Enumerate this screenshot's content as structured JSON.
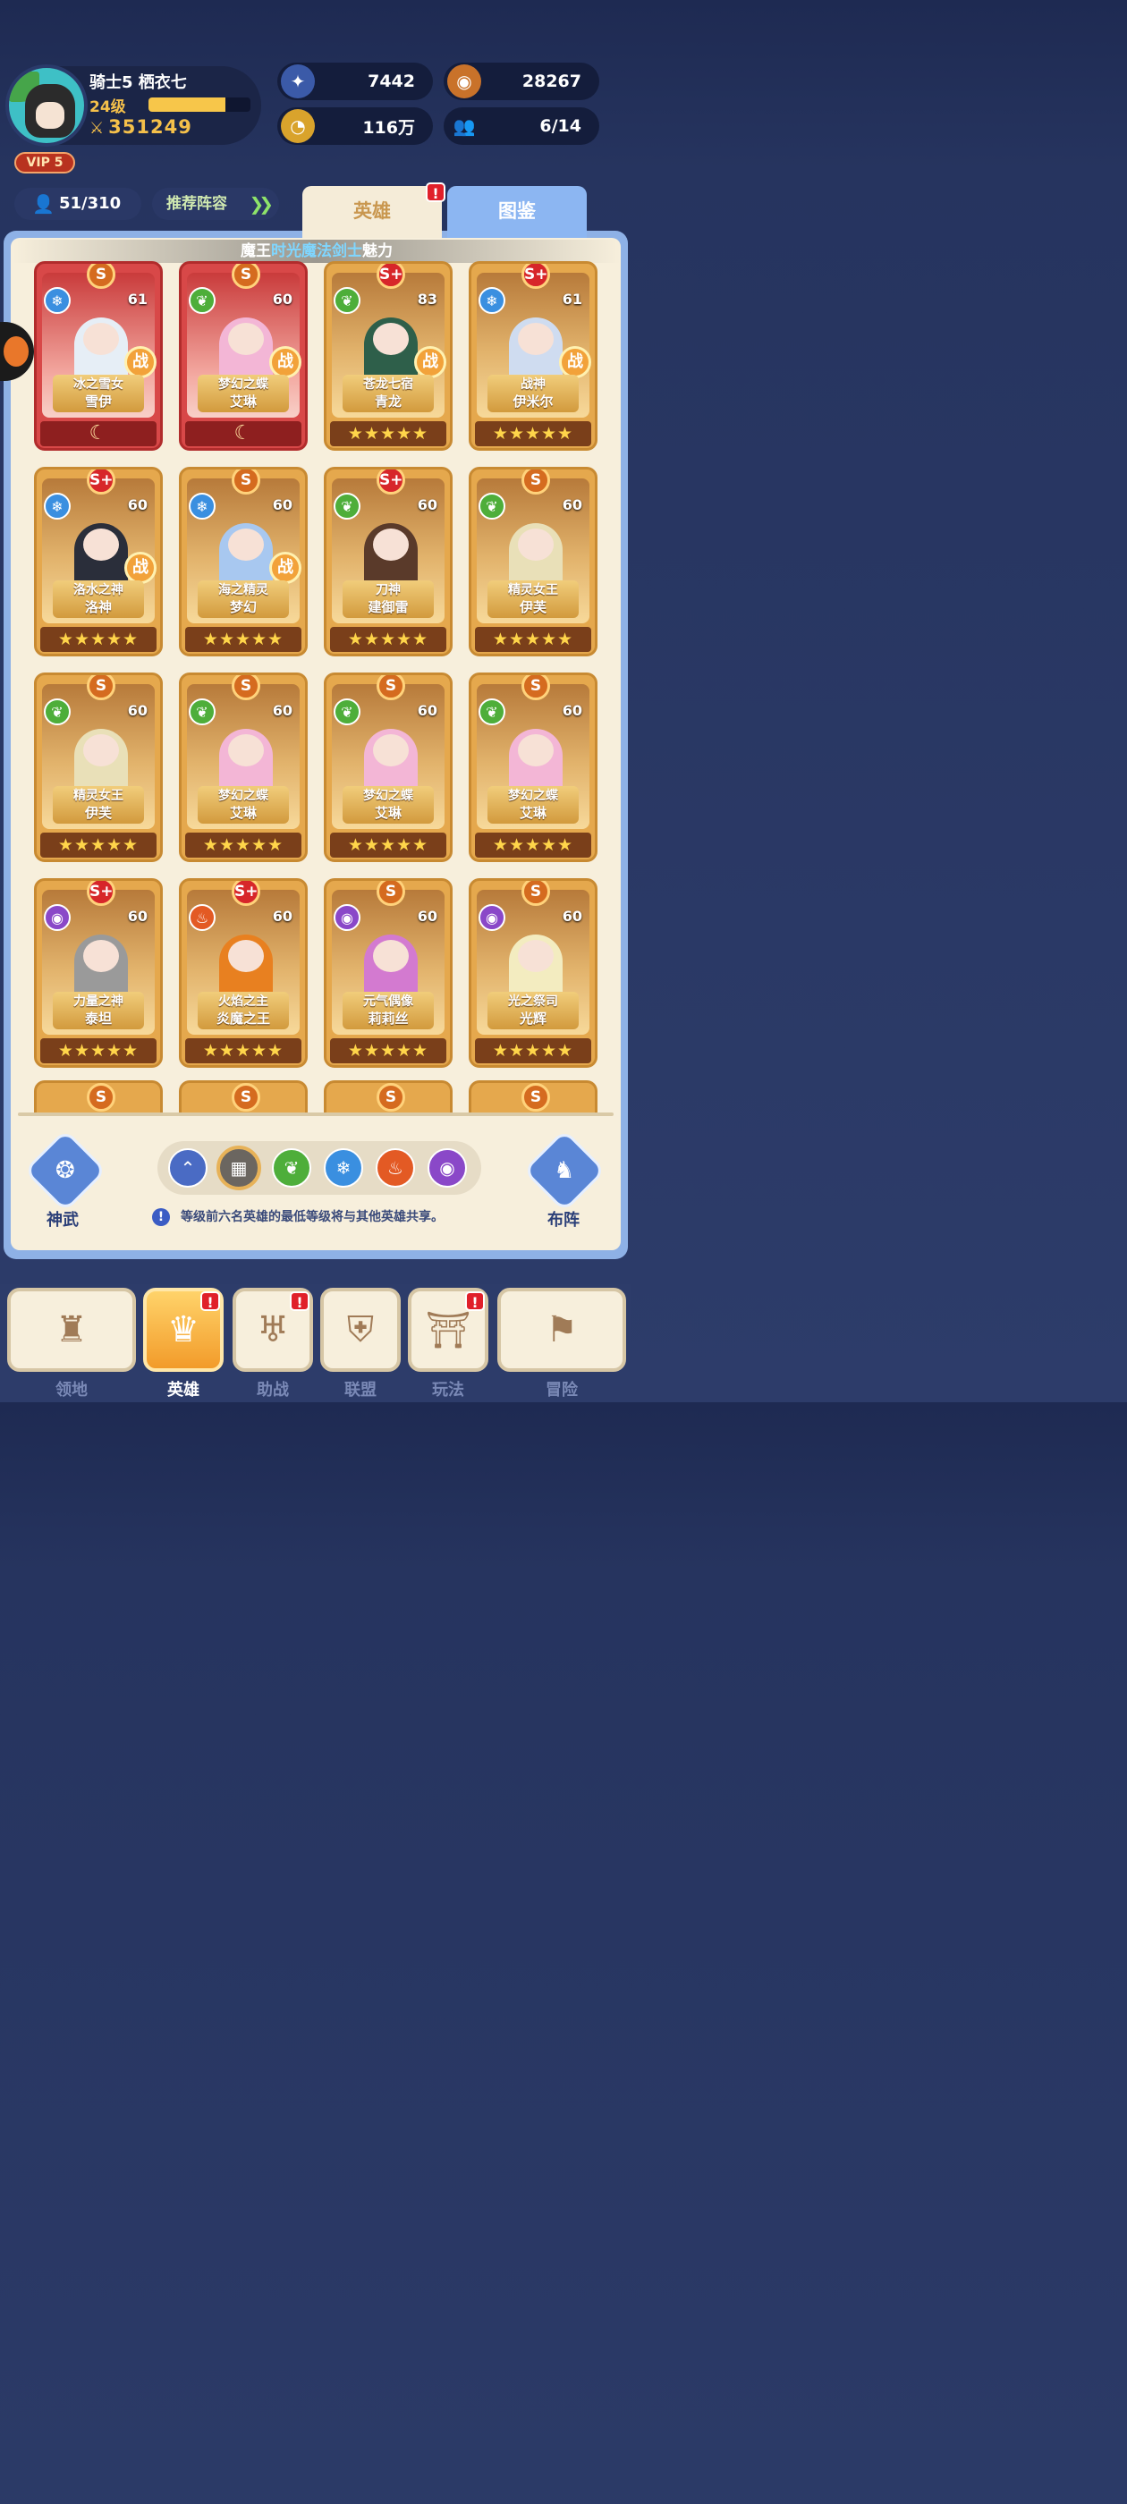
{
  "profile": {
    "name": "骑士5 栖衣七",
    "level": "24级",
    "level_progress": 0.75,
    "power": "351249",
    "vip": "VIP 5"
  },
  "resources": [
    {
      "name": "diamond",
      "icon": "star-gem-icon",
      "value": "7442",
      "color": "#7fa6ff"
    },
    {
      "name": "stamina",
      "icon": "purple-orb-icon",
      "value": "28267",
      "color": "#b77cf0"
    },
    {
      "name": "gold",
      "icon": "gold-coin-icon",
      "value": "116万",
      "color": "#f2c04a"
    },
    {
      "name": "friends",
      "icon": "people-icon",
      "value": "6/14",
      "color": "#ffffff"
    }
  ],
  "hero_count": "51/310",
  "recommend_label": "推荐阵容",
  "tabs": {
    "heroes": "英雄",
    "handbook": "图鉴"
  },
  "ticker": {
    "part1": "魔王",
    "part2": "时光魔法剑士",
    "part3": "魅力"
  },
  "heroes": [
    {
      "title": "冰之雪女",
      "name": "雪伊",
      "level": "61",
      "grade": "S",
      "element": "ice",
      "war": "战",
      "red": true,
      "stars": "☾"
    },
    {
      "title": "梦幻之蝶",
      "name": "艾琳",
      "level": "60",
      "grade": "S",
      "element": "nature",
      "war": "战",
      "red": true,
      "stars": "☾"
    },
    {
      "title": "苍龙七宿",
      "name": "青龙",
      "level": "83",
      "grade": "S+",
      "element": "nature",
      "war": "战",
      "red": false,
      "stars": "★★★★★"
    },
    {
      "title": "战神",
      "name": "伊米尔",
      "level": "61",
      "grade": "S+",
      "element": "ice",
      "war": "战",
      "red": false,
      "stars": "★★★★★"
    },
    {
      "title": "洛水之神",
      "name": "洛神",
      "level": "60",
      "grade": "S+",
      "element": "ice",
      "war": "战",
      "red": false,
      "stars": "★★★★★"
    },
    {
      "title": "海之精灵",
      "name": "梦幻",
      "level": "60",
      "grade": "S",
      "element": "ice",
      "war": "战",
      "red": false,
      "stars": "★★★★★"
    },
    {
      "title": "刀神",
      "name": "建御雷",
      "level": "60",
      "grade": "S+",
      "element": "nature",
      "war": "",
      "red": false,
      "stars": "★★★★★"
    },
    {
      "title": "精灵女王",
      "name": "伊芙",
      "level": "60",
      "grade": "S",
      "element": "nature",
      "war": "",
      "red": false,
      "stars": "★★★★★"
    },
    {
      "title": "精灵女王",
      "name": "伊芙",
      "level": "60",
      "grade": "S",
      "element": "nature",
      "war": "",
      "red": false,
      "stars": "★★★★★"
    },
    {
      "title": "梦幻之蝶",
      "name": "艾琳",
      "level": "60",
      "grade": "S",
      "element": "nature",
      "war": "",
      "red": false,
      "stars": "★★★★★"
    },
    {
      "title": "梦幻之蝶",
      "name": "艾琳",
      "level": "60",
      "grade": "S",
      "element": "nature",
      "war": "",
      "red": false,
      "stars": "★★★★★"
    },
    {
      "title": "梦幻之蝶",
      "name": "艾琳",
      "level": "60",
      "grade": "S",
      "element": "nature",
      "war": "",
      "red": false,
      "stars": "★★★★★"
    },
    {
      "title": "力量之神",
      "name": "泰坦",
      "level": "60",
      "grade": "S+",
      "element": "dark",
      "war": "",
      "red": false,
      "stars": "★★★★★"
    },
    {
      "title": "火焰之主",
      "name": "炎魔之王",
      "level": "60",
      "grade": "S+",
      "element": "fire",
      "war": "",
      "red": false,
      "stars": "★★★★★"
    },
    {
      "title": "元气偶像",
      "name": "莉莉丝",
      "level": "60",
      "grade": "S",
      "element": "dark",
      "war": "",
      "red": false,
      "stars": "★★★★★"
    },
    {
      "title": "光之祭司",
      "name": "光辉",
      "level": "60",
      "grade": "S",
      "element": "dark",
      "war": "",
      "red": false,
      "stars": "★★★★★"
    }
  ],
  "partial_grades": [
    "S",
    "S",
    "S",
    "S"
  ],
  "filters": [
    {
      "icon": "up-chevrons-icon",
      "color": "#4a6bc4"
    },
    {
      "icon": "grid-icon",
      "color": "#6b6660",
      "selected": true
    },
    {
      "icon": "leaf-icon",
      "color": "#4eae3a"
    },
    {
      "icon": "snowflake-icon",
      "color": "#3a8fe0"
    },
    {
      "icon": "flame-icon",
      "color": "#e35a24"
    },
    {
      "icon": "eye-icon",
      "color": "#8a48c8"
    }
  ],
  "side": {
    "left": "神武",
    "right": "布阵"
  },
  "note": "等级前六名英雄的最低等级将与其他英雄共享。",
  "nav": [
    {
      "label": "领地",
      "icon": "castle-icon",
      "active": false,
      "alert": false
    },
    {
      "label": "英雄",
      "icon": "hero-icon",
      "active": true,
      "alert": true
    },
    {
      "label": "助战",
      "icon": "assist-icon",
      "active": false,
      "alert": true
    },
    {
      "label": "联盟",
      "icon": "shield-icon",
      "active": false,
      "alert": false
    },
    {
      "label": "玩法",
      "icon": "gate-icon",
      "active": false,
      "alert": true
    },
    {
      "label": "冒险",
      "icon": "flag-icon",
      "active": false,
      "alert": false
    }
  ]
}
